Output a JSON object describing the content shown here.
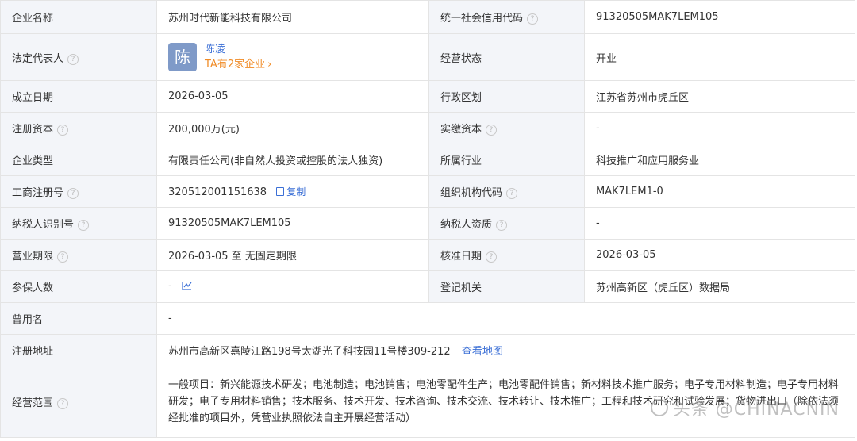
{
  "rows": {
    "company_name": {
      "label": "企业名称",
      "value": "苏州时代新能科技有限公司"
    },
    "credit_code": {
      "label": "统一社会信用代码",
      "value": "91320505MAK7LEM105"
    },
    "legal_rep": {
      "label": "法定代表人",
      "avatar_char": "陈",
      "name": "陈凌",
      "link": "TA有2家企业",
      "chevron": "›"
    },
    "status": {
      "label": "经营状态",
      "value": "开业"
    },
    "founded": {
      "label": "成立日期",
      "value": "2026-03-05"
    },
    "district": {
      "label": "行政区划",
      "value": "江苏省苏州市虎丘区"
    },
    "reg_capital": {
      "label": "注册资本",
      "value": "200,000万(元)"
    },
    "paid_capital": {
      "label": "实缴资本",
      "value": "-"
    },
    "company_type": {
      "label": "企业类型",
      "value": "有限责任公司(非自然人投资或控股的法人独资)"
    },
    "industry": {
      "label": "所属行业",
      "value": "科技推广和应用服务业"
    },
    "reg_number": {
      "label": "工商注册号",
      "value": "320512001151638",
      "copy_label": "复制"
    },
    "org_code": {
      "label": "组织机构代码",
      "value": "MAK7LEM1-0"
    },
    "taxpayer_id": {
      "label": "纳税人识别号",
      "value": "91320505MAK7LEM105"
    },
    "taxpayer_qual": {
      "label": "纳税人资质",
      "value": "-"
    },
    "business_term": {
      "label": "营业期限",
      "value": "2026-03-05 至 无固定期限"
    },
    "approval_date": {
      "label": "核准日期",
      "value": "2026-03-05"
    },
    "insured": {
      "label": "参保人数",
      "value": "-"
    },
    "authority": {
      "label": "登记机关",
      "value": "苏州高新区（虎丘区）数据局"
    },
    "former_name": {
      "label": "曾用名",
      "value": "-"
    },
    "address": {
      "label": "注册地址",
      "value": "苏州市高新区嘉陵江路198号太湖光子科技园11号楼309-212",
      "map_link": "查看地图"
    },
    "scope": {
      "label": "经营范围",
      "value": "一般项目：新兴能源技术研发；电池制造；电池销售；电池零配件生产；电池零配件销售；新材料技术推广服务；电子专用材料制造；电子专用材料研发；电子专用材料销售；技术服务、技术开发、技术咨询、技术交流、技术转让、技术推广；工程和技术研究和试验发展；货物进出口（除依法须经批准的项目外，凭营业执照依法自主开展经营活动）"
    }
  },
  "help_glyph": "?",
  "watermark": "头条 @CHINACNIN",
  "colors": {
    "label_bg": "#f3f5f9",
    "border": "#e4e4e4",
    "link_blue": "#3b6fd6",
    "orange": "#f08a24",
    "avatar_bg": "#7f9ac8"
  }
}
